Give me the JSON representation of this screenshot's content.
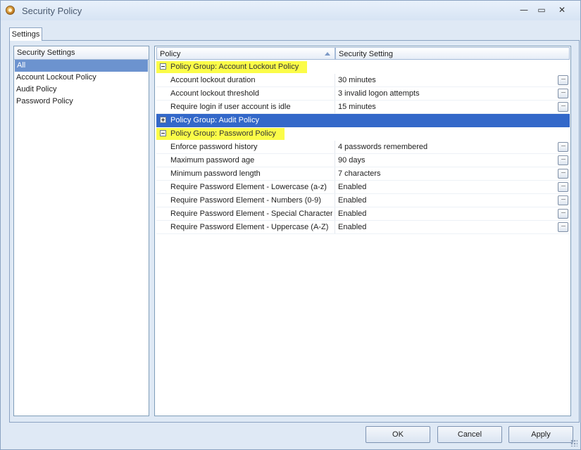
{
  "window": {
    "title": "Security Policy",
    "icon": "app-icon",
    "controls": {
      "minimize": "—",
      "maximize": "▭",
      "close": "✕"
    }
  },
  "tabs": [
    {
      "label": "Settings",
      "active": true
    }
  ],
  "left_panel": {
    "header": "Security Settings",
    "items": [
      {
        "label": "All",
        "selected": true
      },
      {
        "label": "Account Lockout Policy",
        "selected": false
      },
      {
        "label": "Audit Policy",
        "selected": false
      },
      {
        "label": "Password Policy",
        "selected": false
      }
    ]
  },
  "grid": {
    "columns": {
      "policy": "Policy",
      "setting": "Security Setting"
    },
    "sort": "policy-ascending",
    "groups": [
      {
        "label": "Policy Group: Account Lockout Policy",
        "expanded": true,
        "highlighted": true,
        "rows": [
          {
            "policy": "Account lockout duration",
            "setting": "30 minutes"
          },
          {
            "policy": "Account lockout threshold",
            "setting": "3 invalid logon attempts"
          },
          {
            "policy": "Require login if user account is idle",
            "setting": "15 minutes"
          }
        ]
      },
      {
        "label": "Policy Group: Audit Policy",
        "expanded": false,
        "selected": true,
        "rows": []
      },
      {
        "label": "Policy Group: Password Policy",
        "expanded": true,
        "highlighted": true,
        "rows": [
          {
            "policy": "Enforce password history",
            "setting": "4 passwords remembered"
          },
          {
            "policy": "Maximum password age",
            "setting": "90 days"
          },
          {
            "policy": "Minimum password length",
            "setting": "7 characters"
          },
          {
            "policy": "Require Password Element - Lowercase (a-z)",
            "setting": "Enabled"
          },
          {
            "policy": "Require Password Element - Numbers (0-9)",
            "setting": "Enabled"
          },
          {
            "policy": "Require Password Element - Special Characters",
            "setting": "Enabled"
          },
          {
            "policy": "Require Password Element - Uppercase (A-Z)",
            "setting": "Enabled"
          }
        ]
      }
    ],
    "row_button_glyph": "···"
  },
  "buttons": {
    "ok": "OK",
    "cancel": "Cancel",
    "apply": "Apply"
  },
  "colors": {
    "window_bg": "#dfe9f5",
    "selection": "#6c93cf",
    "group_selected": "#3368c9",
    "group_highlight": "#fbfc48"
  }
}
